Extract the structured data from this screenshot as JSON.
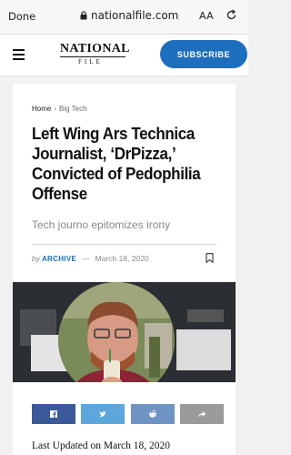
{
  "browser": {
    "done_label": "Done",
    "url": "nationalfile.com",
    "text_size_label": "AA"
  },
  "site": {
    "logo_top": "NATIONAL",
    "logo_bottom": "FILE",
    "subscribe_label": "SUBSCRIBE"
  },
  "article": {
    "breadcrumb": [
      "Home",
      "Big Tech"
    ],
    "title": "Left Wing Ars Technica Journalist, ‘DrPizza,’ Convicted of Pedophilia Offense",
    "subtitle": "Tech journo epitomizes irony",
    "byline_prefix": "by",
    "author": "ARCHIVE",
    "date": "March 18, 2020",
    "last_updated": "Last Updated on March 18, 2020"
  },
  "share": {
    "icons": [
      "facebook-icon",
      "twitter-icon",
      "reddit-icon",
      "share-arrow-icon"
    ]
  },
  "colors": {
    "accent": "#1d6fbe",
    "facebook": "#3b5998",
    "twitter": "#5da7dc",
    "reddit": "#6f94c4",
    "share": "#9b9b9b"
  }
}
